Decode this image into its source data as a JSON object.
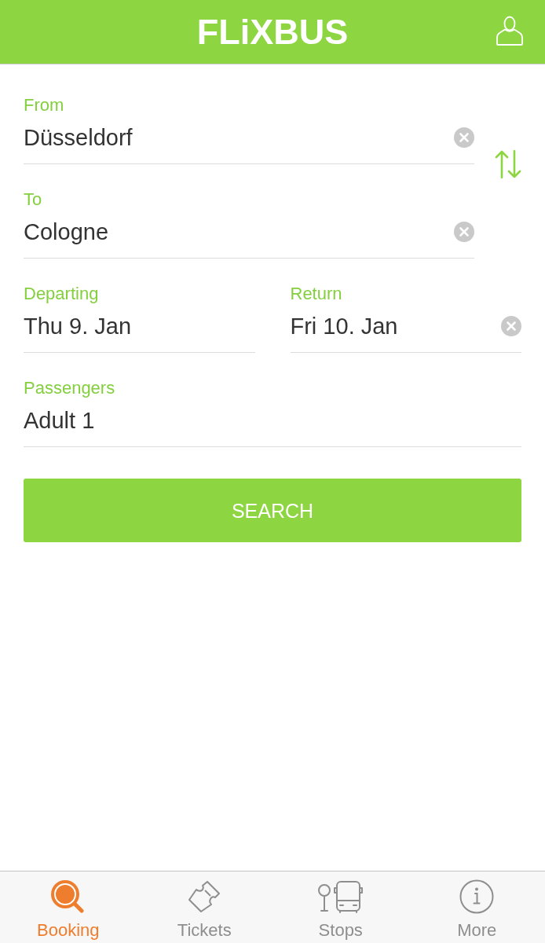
{
  "header": {
    "logo": "FLiXBUS"
  },
  "form": {
    "from": {
      "label": "From",
      "value": "Düsseldorf",
      "clearable": true
    },
    "to": {
      "label": "To",
      "value": "Cologne",
      "clearable": true
    },
    "departing": {
      "label": "Departing",
      "value": "Thu 9. Jan",
      "clearable": false
    },
    "return": {
      "label": "Return",
      "value": "Fri 10. Jan",
      "clearable": true
    },
    "passengers": {
      "label": "Passengers",
      "value": "Adult 1",
      "clearable": false
    }
  },
  "search_button": {
    "label": "SEARCH"
  },
  "tab_bar": [
    {
      "label": "Booking",
      "selected": true
    },
    {
      "label": "Tickets",
      "selected": false
    },
    {
      "label": "Stops",
      "selected": false
    },
    {
      "label": "More",
      "selected": false
    }
  ]
}
